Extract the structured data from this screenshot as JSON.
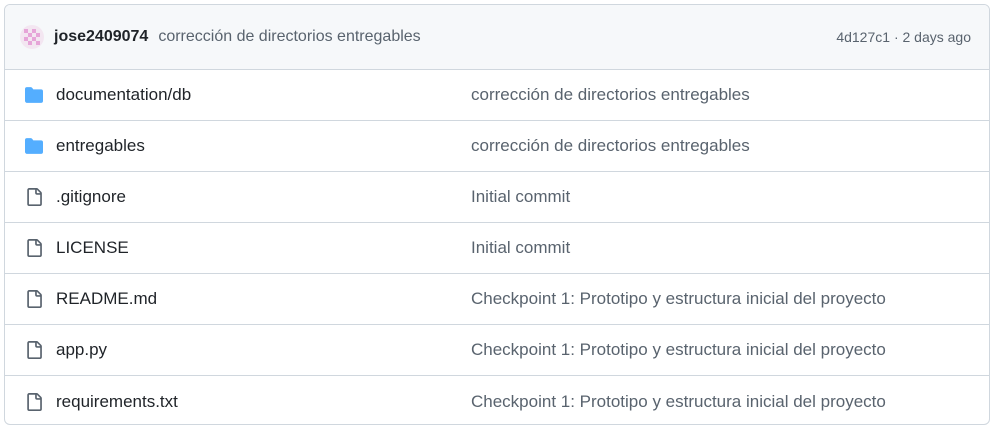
{
  "latest_commit": {
    "author": "jose2409074",
    "message": "corrección de directorios entregables",
    "hash": "4d127c1",
    "separator": "·",
    "time": "2 days ago"
  },
  "files": [
    {
      "type": "folder",
      "icon": "folder-icon",
      "name": "documentation/db",
      "commit": "corrección de directorios entregables"
    },
    {
      "type": "folder",
      "icon": "folder-icon",
      "name": "entregables",
      "commit": "corrección de directorios entregables"
    },
    {
      "type": "file",
      "icon": "file-icon",
      "name": ".gitignore",
      "commit": "Initial commit"
    },
    {
      "type": "file",
      "icon": "file-icon",
      "name": "LICENSE",
      "commit": "Initial commit"
    },
    {
      "type": "file",
      "icon": "file-icon",
      "name": "README.md",
      "commit": "Checkpoint 1: Prototipo y estructura inicial del proyecto"
    },
    {
      "type": "file",
      "icon": "file-icon",
      "name": "app.py",
      "commit": "Checkpoint 1: Prototipo y estructura inicial del proyecto"
    },
    {
      "type": "file",
      "icon": "file-icon",
      "name": "requirements.txt",
      "commit": "Checkpoint 1: Prototipo y estructura inicial del proyecto"
    }
  ],
  "colors": {
    "folder": "#54aeff",
    "file_icon": "#59636e",
    "border": "#d0d7de",
    "header_bg": "#f6f8fa",
    "muted_text": "#59636e",
    "avatar_pink": "#e6a5d8"
  }
}
